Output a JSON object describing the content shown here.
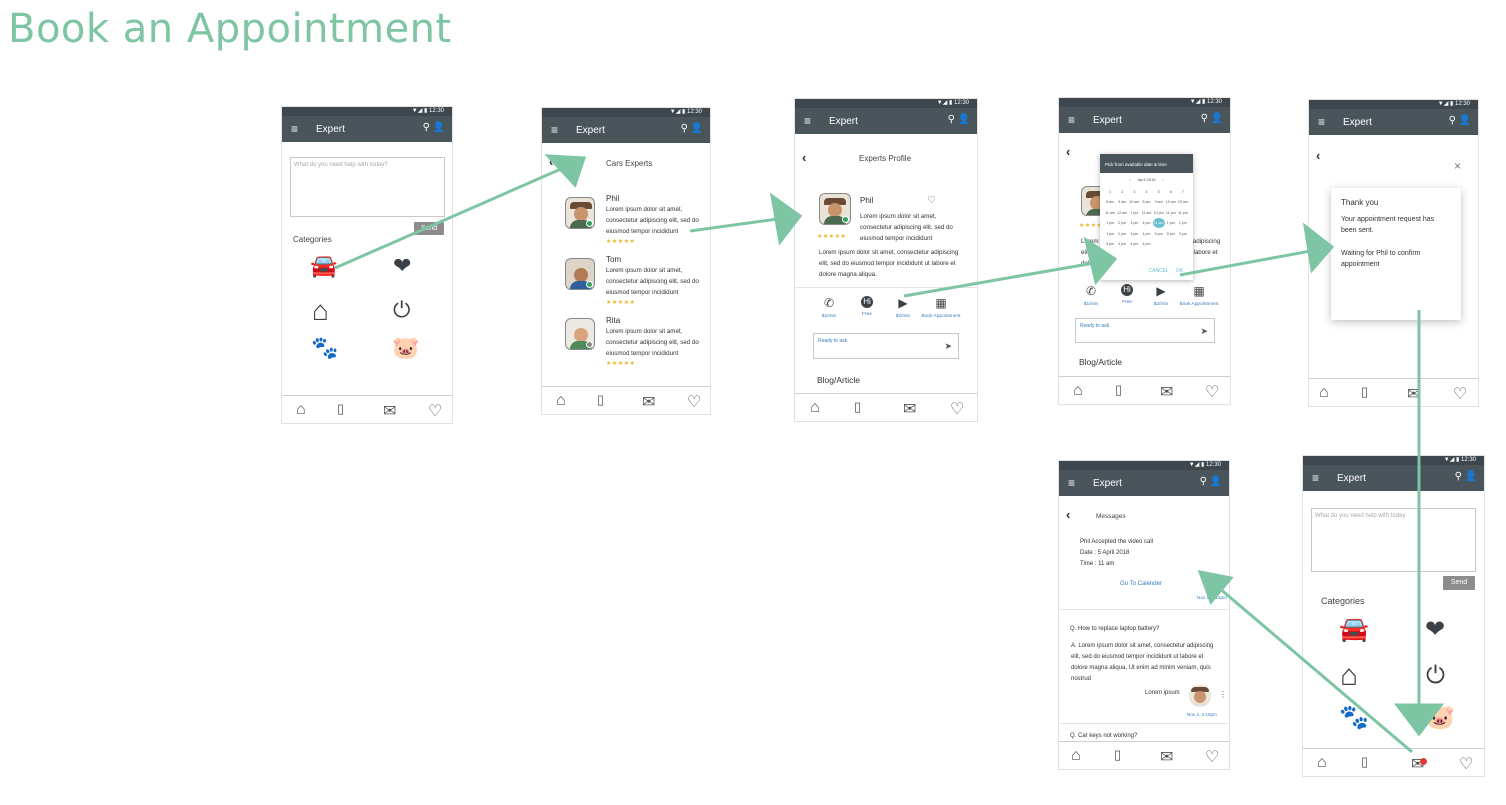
{
  "page_title": "Book an Appointment",
  "status_time": "12:30",
  "status_icons": "▼◢ ▮",
  "app_title": "Expert",
  "icons": {
    "menu": "≡",
    "search": "⚲",
    "person": "👤",
    "back": "‹",
    "close": "×",
    "send": "➤",
    "heart": "♡"
  },
  "home_screen": {
    "search_placeholder": "What do you need help with today?",
    "send_label": "Send",
    "categories_label": "Categories",
    "categories": [
      {
        "name": "car",
        "glyph": "🚘"
      },
      {
        "name": "health",
        "glyph": "❤"
      },
      {
        "name": "home",
        "glyph": "⌂"
      },
      {
        "name": "electric",
        "glyph": "⏻"
      },
      {
        "name": "pets",
        "glyph": "🐾"
      },
      {
        "name": "finance",
        "glyph": "🐷"
      }
    ]
  },
  "experts_screen": {
    "heading": "Cars Experts",
    "experts": [
      {
        "name": "Phil",
        "desc": "Lorem ipsum dolor sit amet, consectetur adipiscing elit, sed do eiusmod tempor incididunt",
        "stars": "★★★★★"
      },
      {
        "name": "Tom",
        "desc": "Lorem ipsum dolor sit amet, consectetur adipiscing elit, sed do eiusmod tempor incididunt",
        "stars": "★★★★★"
      },
      {
        "name": "Rita",
        "desc": "Lorem ipsum dolor sit amet, consectetur adipiscing elit, sed do eiusmod tempor incididunt",
        "stars": "★★★★★"
      }
    ]
  },
  "profile_screen": {
    "heading": "Experts Profile",
    "name": "Phil",
    "desc": "Lorem ipsum dolor sit amet, consectetur adipiscing elit, sed do eiusmod tempor incididunt",
    "bio": "Lorem ipsum dolor sit amet, consectetur adipiscing elit, sed do eiusmod tempor incididunt ut labore et dolore magna aliqua.",
    "stars": "★★★★★",
    "actions": [
      {
        "name": "call",
        "glyph": "✆",
        "label": "$1/min"
      },
      {
        "name": "chat",
        "glyph": "Hi",
        "label": "Free"
      },
      {
        "name": "video",
        "glyph": "▶",
        "label": "$2/min"
      },
      {
        "name": "book",
        "glyph": "▦",
        "label": "Book Appointment"
      }
    ],
    "ask_placeholder": "Ready to ask.",
    "blog_label": "Blog/Article"
  },
  "picker_screen": {
    "dialog_title": "Pick from available date & time",
    "month": "April 2018",
    "cancel_label": "CANCEL",
    "ok_label": "OK",
    "day_numbers": [
      "",
      "",
      "",
      "",
      "",
      "",
      "",
      "1",
      "2",
      "3",
      "4",
      "5",
      "6",
      "7"
    ],
    "slots": [
      "8 am",
      "9 am",
      "10 am",
      "8 am",
      "9 am",
      "10 am",
      "10 am",
      "11 am",
      "12 am",
      "1 pm",
      "11 am",
      "10 pm",
      "11 pm",
      "11 pm",
      "1 pm",
      "2 pm",
      "3 pm",
      "4 pm",
      "11 am",
      "1 pm",
      "1 pm",
      "1 pm",
      "2 pm",
      "3 pm",
      "4 pm",
      "5 pm",
      "5 pm",
      "3 pm",
      "5 pm",
      "4 pm",
      "4 pm",
      "4 pm",
      "",
      "",
      "",
      ""
    ],
    "selected_slot": "11 am",
    "ask_placeholder": "Ready to ask.",
    "blog_label": "Blog/Article"
  },
  "thanks_screen": {
    "title": "Thank you",
    "line1": "Your appointment request has been sent.",
    "line2": "Waiting for Phil to confirm appointment"
  },
  "messages_screen": {
    "heading": "Messages",
    "accepted": "Phil Accepted the video call",
    "date": "Date : 5 April 2018",
    "time": "Time : 11 am",
    "calendar_link": "Go To Calender",
    "stamp1": "Nov 2, 2:15pm",
    "question": "Q. How to replace laptop battery?",
    "answer": "A. Lorem ipsum dolor sit amet, consectetur adipiscing elit, sed do eiusmod tempor incididunt ut labore et dolore magna aliqua. Ut enim ad minim veniam, quis nostrud",
    "answer_sig": "Lorem ipsum",
    "stamp2": "Nov 2, 2:15pm",
    "question2": "Q. Car keys not working?"
  },
  "home_screen_2": {
    "search_placeholder": "What do you need help with today",
    "send_label": "Send",
    "categories_label": "Categories"
  },
  "nav": {
    "blog_label": "Blog"
  },
  "colors": {
    "accent": "#7dc5a3",
    "appbar": "#4a545b",
    "statusbar": "#3e474d",
    "link": "#3a7bbf",
    "star": "#f0b429",
    "notification": "#e53935"
  }
}
